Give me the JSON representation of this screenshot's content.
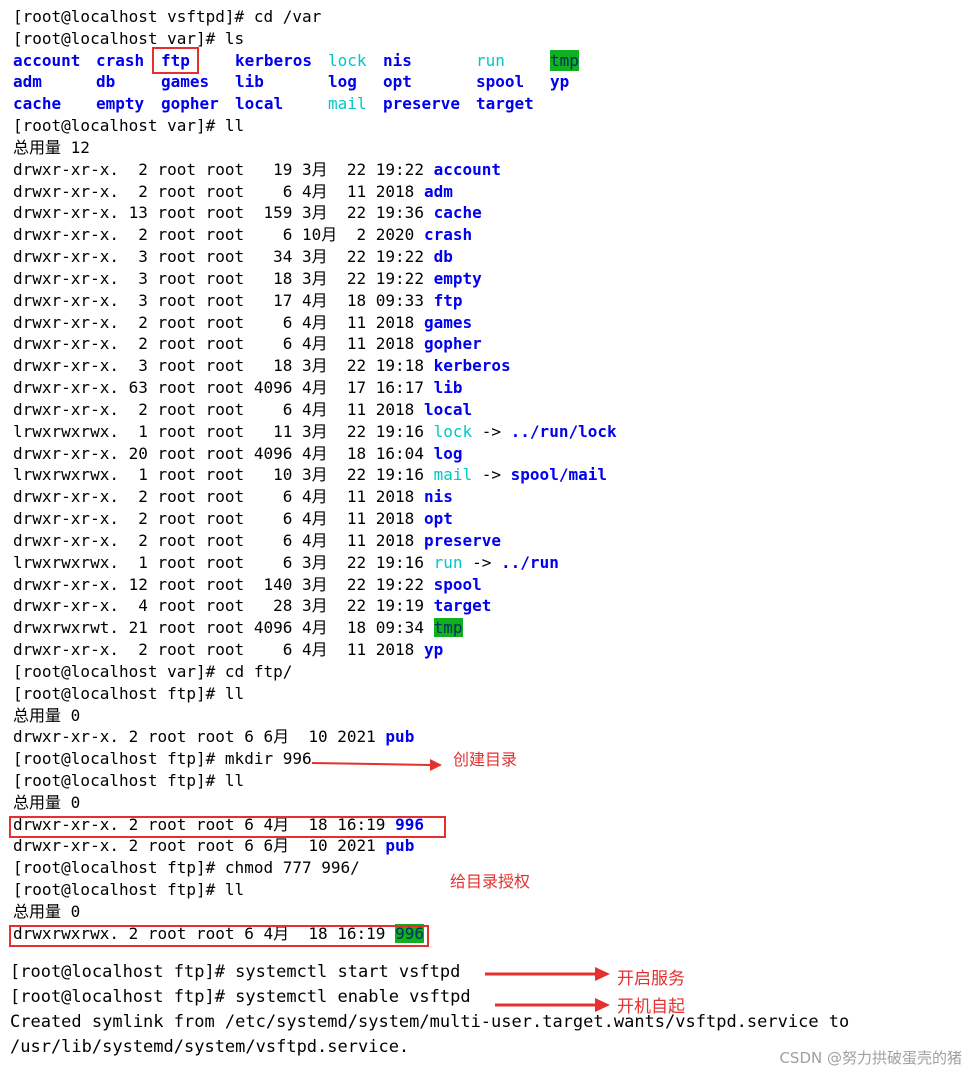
{
  "terminal": {
    "cmd1": "[root@localhost vsftpd]# cd /var",
    "cmd2": "[root@localhost var]# ls",
    "ls_rows": [
      [
        "account",
        "crash",
        "ftp",
        "kerberos",
        "lock",
        "nis",
        "run",
        "tmp"
      ],
      [
        "adm",
        "db",
        "games",
        "lib",
        "log",
        "opt",
        "spool",
        "yp"
      ],
      [
        "cache",
        "empty",
        "gopher",
        "local",
        "mail",
        "preserve",
        "target",
        ""
      ]
    ],
    "cmd3": "[root@localhost var]# ll",
    "total1": "总用量 12",
    "entries": [
      {
        "meta": "drwxr-xr-x.  2 root root   19 3月  22 19:22 ",
        "name": "account",
        "style": "blue"
      },
      {
        "meta": "drwxr-xr-x.  2 root root    6 4月  11 2018 ",
        "name": "adm",
        "style": "blue"
      },
      {
        "meta": "drwxr-xr-x. 13 root root  159 3月  22 19:36 ",
        "name": "cache",
        "style": "blue"
      },
      {
        "meta": "drwxr-xr-x.  2 root root    6 10月  2 2020 ",
        "name": "crash",
        "style": "blue"
      },
      {
        "meta": "drwxr-xr-x.  3 root root   34 3月  22 19:22 ",
        "name": "db",
        "style": "blue"
      },
      {
        "meta": "drwxr-xr-x.  3 root root   18 3月  22 19:22 ",
        "name": "empty",
        "style": "blue"
      },
      {
        "meta": "drwxr-xr-x.  3 root root   17 4月  18 09:33 ",
        "name": "ftp",
        "style": "blue"
      },
      {
        "meta": "drwxr-xr-x.  2 root root    6 4月  11 2018 ",
        "name": "games",
        "style": "blue"
      },
      {
        "meta": "drwxr-xr-x.  2 root root    6 4月  11 2018 ",
        "name": "gopher",
        "style": "blue"
      },
      {
        "meta": "drwxr-xr-x.  3 root root   18 3月  22 19:18 ",
        "name": "kerberos",
        "style": "blue"
      },
      {
        "meta": "drwxr-xr-x. 63 root root 4096 4月  17 16:17 ",
        "name": "lib",
        "style": "blue"
      },
      {
        "meta": "drwxr-xr-x.  2 root root    6 4月  11 2018 ",
        "name": "local",
        "style": "blue"
      },
      {
        "meta": "lrwxrwxrwx.  1 root root   11 3月  22 19:16 ",
        "name": "lock",
        "style": "cyan",
        "arrow": " -> ",
        "target": "../run/lock"
      },
      {
        "meta": "drwxr-xr-x. 20 root root 4096 4月  18 16:04 ",
        "name": "log",
        "style": "blue"
      },
      {
        "meta": "lrwxrwxrwx.  1 root root   10 3月  22 19:16 ",
        "name": "mail",
        "style": "cyan",
        "arrow": " -> ",
        "target": "spool/mail"
      },
      {
        "meta": "drwxr-xr-x.  2 root root    6 4月  11 2018 ",
        "name": "nis",
        "style": "blue"
      },
      {
        "meta": "drwxr-xr-x.  2 root root    6 4月  11 2018 ",
        "name": "opt",
        "style": "blue"
      },
      {
        "meta": "drwxr-xr-x.  2 root root    6 4月  11 2018 ",
        "name": "preserve",
        "style": "blue"
      },
      {
        "meta": "lrwxrwxrwx.  1 root root    6 3月  22 19:16 ",
        "name": "run",
        "style": "cyan",
        "arrow": " -> ",
        "target": "../run"
      },
      {
        "meta": "drwxr-xr-x. 12 root root  140 3月  22 19:22 ",
        "name": "spool",
        "style": "blue"
      },
      {
        "meta": "drwxr-xr-x.  4 root root   28 3月  22 19:19 ",
        "name": "target",
        "style": "blue"
      },
      {
        "meta": "drwxrwxrwt. 21 root root 4096 4月  18 09:34 ",
        "name": "tmp",
        "style": "green"
      },
      {
        "meta": "drwxr-xr-x.  2 root root    6 4月  11 2018 ",
        "name": "yp",
        "style": "blue"
      }
    ],
    "cmd4": "[root@localhost var]# cd ftp/",
    "cmd5": "[root@localhost ftp]# ll",
    "total2": "总用量 0",
    "pub1_meta": "drwxr-xr-x. 2 root root 6 6月  10 2021 ",
    "pub_name": "pub",
    "cmd6": "[root@localhost ftp]# mkdir 996",
    "cmd7": "[root@localhost ftp]# ll",
    "total3": "总用量 0",
    "dir996_meta": "drwxr-xr-x. 2 root root 6 4月  18 16:19 ",
    "dir996_name": "996",
    "pub2_meta": "drwxr-xr-x. 2 root root 6 6月  10 2021 ",
    "cmd8": "[root@localhost ftp]# chmod 777 996/",
    "cmd9": "[root@localhost ftp]# ll",
    "total4": "总用量 0",
    "dir996b_meta": "drwxrwxrwx. 2 root root 6 4月  18 16:19 ",
    "cmd10": "[root@localhost ftp]# systemctl start vsftpd",
    "cmd11": "[root@localhost ftp]# systemctl enable vsftpd",
    "out1": "Created symlink from /etc/systemd/system/multi-user.target.wants/vsftpd.service to",
    "out2": "/usr/lib/systemd/system/vsftpd.service."
  },
  "annotations": {
    "mkdir": "创建目录",
    "chmod": "给目录授权",
    "start": "开启服务",
    "enable": "开机自起"
  },
  "watermark": "CSDN @努力拱破蛋壳的猪",
  "colors": {
    "dir": "#0000ee",
    "link": "#00c8c8",
    "sticky_bg": "#10b020",
    "annotation": "#e53030"
  }
}
